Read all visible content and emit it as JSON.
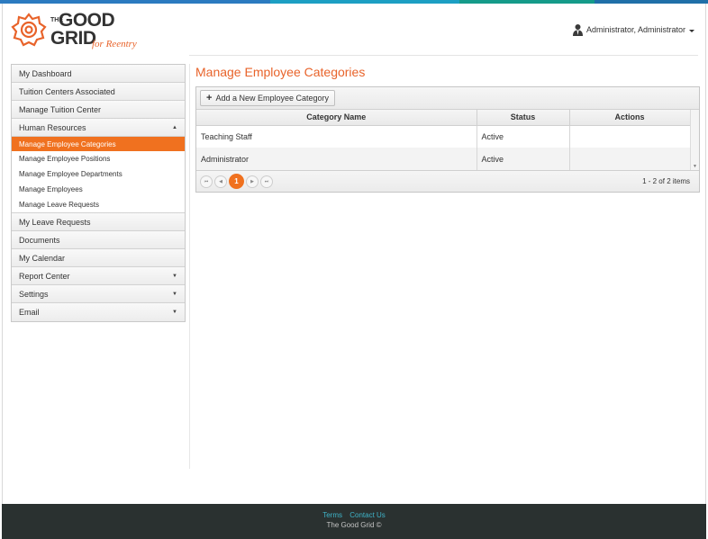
{
  "topbar_colors": [
    "#2c7bc0",
    "#1c9fc3",
    "#159b8a",
    "#1f6fa8"
  ],
  "brand": {
    "the": "THE",
    "good": "GOOD",
    "grid": "GRID",
    "tagline": "for Reentry",
    "accent_color": "#e8632a"
  },
  "user": {
    "name": "Administrator, Administrator",
    "icon": "user-icon"
  },
  "sidebar": {
    "items": [
      {
        "label": "My Dashboard"
      },
      {
        "label": "Tuition Centers Associated"
      },
      {
        "label": "Manage Tuition Center"
      },
      {
        "label": "Human Resources",
        "arrow": "▲"
      }
    ],
    "submenu": [
      {
        "label": "Manage Employee Categories",
        "active": true
      },
      {
        "label": "Manage Employee Positions"
      },
      {
        "label": "Manage Employee Departments"
      },
      {
        "label": "Manage Employees"
      },
      {
        "label": "Manage Leave Requests"
      }
    ],
    "items_after": [
      {
        "label": "My Leave Requests"
      },
      {
        "label": "Documents"
      },
      {
        "label": "My Calendar"
      },
      {
        "label": "Report Center",
        "arrow": "▼"
      },
      {
        "label": "Settings",
        "arrow": "▼"
      },
      {
        "label": "Email",
        "arrow": "▼"
      }
    ]
  },
  "main": {
    "title": "Manage Employee Categories",
    "add_button": "Add a New Employee Category",
    "columns": [
      "Category Name",
      "Status",
      "Actions"
    ],
    "rows": [
      {
        "name": "Teaching Staff",
        "status": "Active",
        "actions": ""
      },
      {
        "name": "Administrator",
        "status": "Active",
        "actions": ""
      }
    ],
    "pager": {
      "current_page": "1",
      "info": "1 - 2 of 2 items"
    }
  },
  "footer": {
    "terms": "Terms",
    "contact": "Contact Us",
    "copyright": "The Good Grid ©"
  }
}
